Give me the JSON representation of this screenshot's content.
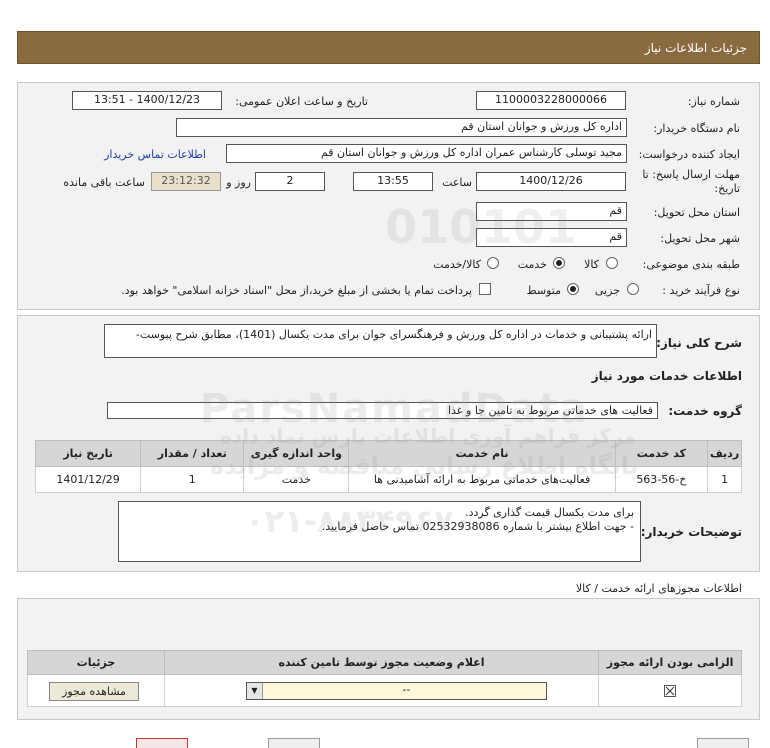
{
  "header": {
    "title": "جزئیات اطلاعات نیاز"
  },
  "form": {
    "need_number_label": "شماره نیاز:",
    "need_number": "1100003228000066",
    "announce_label": "تاریخ و ساعت اعلان عمومی:",
    "announce_value": "1400/12/23 - 13:51",
    "buyer_org_label": "نام دستگاه خریدار:",
    "buyer_org": "اداره کل ورزش و جوانان استان قم",
    "creator_label": "ایجاد کننده درخواست:",
    "creator": "مجید توسلی کارشناس عمران اداره کل ورزش و جوانان استان قم",
    "contact_link": "اطلاعات تماس خریدار",
    "deadline_label_1": "مهلت ارسال پاسخ: تا",
    "deadline_label_2": "تاریخ:",
    "deadline_date": "1400/12/26",
    "time_label": "ساعت",
    "deadline_time": "13:55",
    "days_value": "2",
    "days_label": "روز و",
    "remaining_time": "23:12:32",
    "remaining_label": "ساعت باقی مانده",
    "province_label": "استان محل تحویل:",
    "province": "قم",
    "city_label": "شهر محل تحویل:",
    "city": "قم",
    "category_label": "طبقه بندی موضوعی:",
    "category_options": [
      "کالا",
      "خدمت",
      "کالا/خدمت"
    ],
    "process_label": "نوع فرآیند خرید :",
    "process_options": [
      "جزیی",
      "متوسط"
    ],
    "payment_note": "پرداخت تمام یا بخشی از مبلغ خرید،از محل \"اسناد خزانه اسلامی\" خواهد بود."
  },
  "summary": {
    "label": "شرح کلی نیاز:",
    "text": "ارائه پشتیبانی و خدمات در اداره کل ورزش و فرهنگسرای جوان برای مدت یکسال (1401)، مطابق شرح پیوست-",
    "services_heading": "اطلاعات خدمات مورد نیاز",
    "service_group_label": "گروه خدمت:",
    "service_group": "فعالیت های خدماتی مربوط به تامین جا و غذا"
  },
  "items_table": {
    "headers": [
      "ردیف",
      "کد خدمت",
      "نام خدمت",
      "واحد اندازه گیری",
      "تعداد / مقدار",
      "تاریخ نیاز"
    ],
    "rows": [
      [
        "1",
        "خ-56-563",
        "فعالیت‌های خدماتی مربوط به ارائه آشامیدنی ها",
        "خدمت",
        "1",
        "1401/12/29"
      ]
    ]
  },
  "buyer_notes": {
    "label": "توضیحات خریدار:",
    "line1": "برای مدت یکسال قیمت گذاری گردد.",
    "line2": "- جهت اطلاع بیشتر با شماره 02532938086 تماس حاصل فرمایید."
  },
  "permits": {
    "heading": "اطلاعات مجوزهای ارائه خدمت / کالا",
    "headers": [
      "الزامی بودن ارائه مجوز",
      "اعلام وضعیت مجوز توسط تامین کننده",
      "جزئیات"
    ],
    "status_value": "--",
    "view_button": "مشاهده مجوز"
  },
  "watermark": {
    "line1": "ParsNamadData",
    "line2": "مرکز فراهم آوری اطلاعات پارس نماد داده",
    "line3": "پایگاه اطلاع رسانی مناقصه و مزایده",
    "phone": "۰۲۱-۸۸۳۴۹۶۷۰"
  }
}
